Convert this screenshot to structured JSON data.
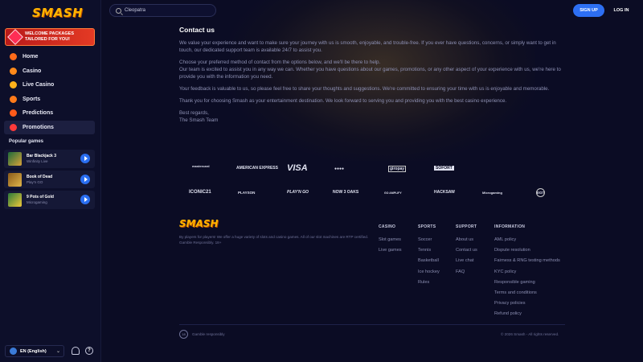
{
  "brand": {
    "name": "SMASH",
    "accent": "#2d6ff3"
  },
  "sidebar": {
    "promo": "WELCOME PACKAGES TAILORED FOR YOU!",
    "nav": [
      {
        "label": "Home",
        "icon": "home-icon",
        "color": "#ff6b1a"
      },
      {
        "label": "Casino",
        "icon": "cards-icon",
        "color": "#ff8a1a"
      },
      {
        "label": "Live Casino",
        "icon": "live-icon",
        "color": "#ffb11a"
      },
      {
        "label": "Sports",
        "icon": "football-icon",
        "color": "#ff7a1a"
      },
      {
        "label": "Predictions",
        "icon": "predictions-icon",
        "color": "#ff5a1a"
      },
      {
        "label": "Promotions",
        "icon": "promotions-icon",
        "color": "#ff3a3a"
      }
    ],
    "popular_title": "Popular games",
    "games": [
      {
        "name": "Bar Blackjack 3",
        "provider": "Winfinity Live"
      },
      {
        "name": "Book of Dead",
        "provider": "Play'n GO"
      },
      {
        "name": "9 Pots of Gold",
        "provider": "Microgaming"
      }
    ],
    "language": "EN (English)"
  },
  "topbar": {
    "search_value": "Cleopatra",
    "signup": "SIGN UP",
    "login": "LOG IN"
  },
  "content": {
    "title": "Contact us",
    "paragraphs": [
      "We value your experience and want to make sure your journey with us is smooth, enjoyable, and trouble-free. If you ever have questions, concerns, or simply want to get in touch, our dedicated support team is available 24/7 to assist you.",
      "Choose your preferred method of contact from the options below, and we'll be there to help.",
      "Our team is excited to assist you in any way we can. Whether you have questions about our games, promotions, or any other aspect of your experience with us, we're here to provide you with the information you need.",
      "Your feedback is valuable to us, so please feel free to share your thoughts and suggestions. We're committed to ensuring your time with us is enjoyable and memorable.",
      "Thank you for choosing Smash as your entertainment destination. We look forward to serving you and providing you with the best casino experience.",
      "Best regards,",
      "The Smash Team"
    ]
  },
  "payments": [
    "mastercard",
    "AMERICAN EXPRESS",
    "VISA",
    "●●●●",
    "giropay",
    "SOFORT"
  ],
  "providers": [
    "ICONIC21",
    "PLAYSON",
    "PLAY'N GO",
    "NOW 3 OAKS",
    "GO AMPLIFY",
    "HACKSAW",
    "Microgaming",
    "EGT"
  ],
  "footer": {
    "description": "By players for players! We offer a huge variety of slots and casino games. All of our slot machines are RTP certified. Gamble Responsibly. 18+",
    "columns": [
      {
        "title": "CASINO",
        "links": [
          "Slot games",
          "Live games"
        ]
      },
      {
        "title": "SPORTS",
        "links": [
          "Soccer",
          "Tennis",
          "Basketball",
          "Ice hockey",
          "Rules"
        ]
      },
      {
        "title": "SUPPORT",
        "links": [
          "About us",
          "Contact us",
          "Live chat",
          "FAQ"
        ]
      },
      {
        "title": "INFORMATION",
        "links": [
          "AML policy",
          "Dispute resolution",
          "Fairness & RNG testing methods",
          "KYC policy",
          "Responsible gaming",
          "Terms and conditions",
          "Privacy policies",
          "Refund policy"
        ]
      }
    ],
    "age": "18",
    "gamble": "Gamble responsibly",
    "copyright": "© 2026 Smash - All rights reserved."
  }
}
